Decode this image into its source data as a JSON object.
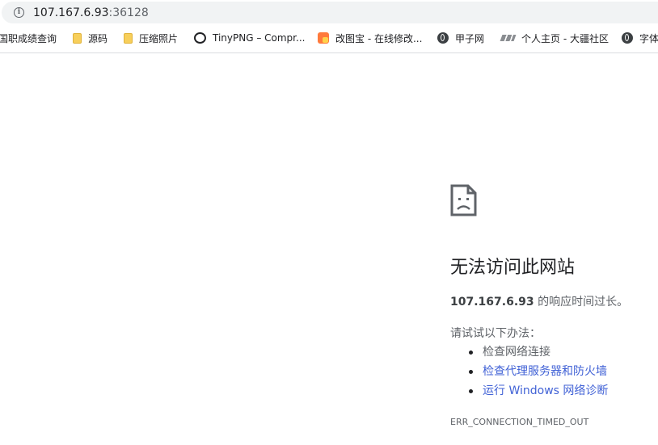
{
  "address_bar": {
    "host": "107.167.6.93",
    "port": ":36128"
  },
  "bookmarks": [
    {
      "label": "国职成绩查询",
      "icon": "none"
    },
    {
      "label": "源码",
      "icon": "folder-icon"
    },
    {
      "label": "压缩照片",
      "icon": "folder-icon"
    },
    {
      "label": "TinyPNG – Compr...",
      "icon": "panda-icon"
    },
    {
      "label": "改图宝 - 在线修改...",
      "icon": "orange-app-icon"
    },
    {
      "label": "甲子网",
      "icon": "globe-icon"
    },
    {
      "label": "个人主页 - 大疆社区",
      "icon": "dji-icon"
    },
    {
      "label": "字体",
      "icon": "globe-icon"
    }
  ],
  "error": {
    "heading": "无法访问此网站",
    "host": "107.167.6.93",
    "summary_suffix": " 的响应时间过长。",
    "suggest_title": "请试试以下办法：",
    "suggestions": [
      {
        "label": "检查网络连接",
        "link": false
      },
      {
        "label": "检查代理服务器和防火墙",
        "link": true
      },
      {
        "label": "运行 Windows 网络诊断",
        "link": true
      }
    ],
    "code": "ERR_CONNECTION_TIMED_OUT"
  },
  "colors": {
    "link": "#4162d6",
    "text_secondary": "#5f6368",
    "text_primary": "#202124"
  }
}
